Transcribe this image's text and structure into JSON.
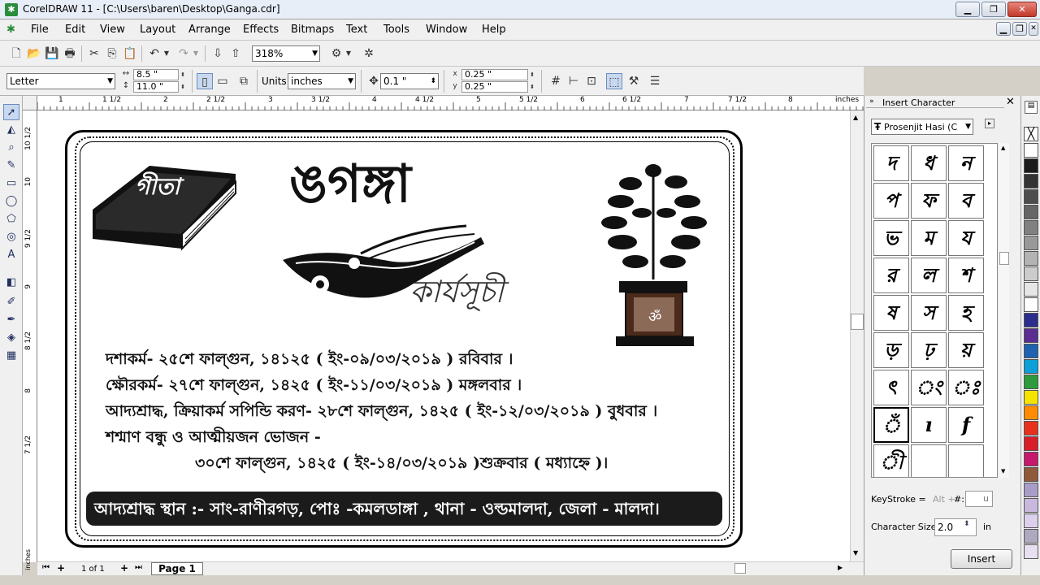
{
  "window": {
    "title": "CorelDRAW 11 - [C:\\Users\\baren\\Desktop\\Ganga.cdr]",
    "app_icon": "corel-balloon-icon"
  },
  "menu": {
    "items": [
      "File",
      "Edit",
      "View",
      "Layout",
      "Arrange",
      "Effects",
      "Bitmaps",
      "Text",
      "Tools",
      "Window",
      "Help"
    ]
  },
  "toolbar": {
    "zoom": "318%"
  },
  "property_bar": {
    "paper": "Letter",
    "width": "8.5 \"",
    "height": "11.0 \"",
    "units_label": "Units:",
    "units": "inches",
    "nudge": "0.1 \"",
    "dup_x": "0.25 \"",
    "dup_y": "0.25 \""
  },
  "rulers": {
    "h_labels": [
      "1",
      "1 1/2",
      "2",
      "2 1/2",
      "3",
      "3 1/2",
      "4",
      "4 1/2",
      "5",
      "5 1/2",
      "6",
      "6 1/2",
      "7",
      "7 1/2",
      "8"
    ],
    "unit": "inches",
    "v_labels": [
      "10 1/2",
      "10",
      "9 1/2",
      "9",
      "8 1/2",
      "8",
      "7 1/2"
    ]
  },
  "document": {
    "title": "ঙগঙ্গা",
    "subtitle": "কার্যসূচী",
    "book_title": "গীতা",
    "lines": [
      "দশাকর্ম- ২৫শে ফাল্গুন, ১৪১২৫ ( ইং-০৯/০৩/২০১৯ ) রবিবার ।",
      "ক্ষৌরকর্ম- ২৭শে ফাল্গুন, ১৪২৫ ( ইং-১১/০৩/২০১৯ ) মঙ্গলবার ।",
      "আদ্যশ্রাদ্ধ, ক্রিয়াকর্ম সপিন্ডি করণ- ২৮শে ফাল্গুন, ১৪২৫ ( ইং-১২/০৩/২০১৯ ) বুধবার ।",
      "শশ্মাণ বন্ধু ও আত্মীয়জন ভোজন -",
      "৩০শে ফাল্গুন, ১৪২৫ ( ইং-১৪/০৩/২০১৯ )শুক্রবার  ( মধ্যাহ্নে )।"
    ],
    "banner": "আদ্যশ্রাদ্ধ স্থান :- সাং-রাণীরগড়, পোঃ -কমলডাঙ্গা , থানা - ওল্ডমালদা, জেলা - মালদা।"
  },
  "page_nav": {
    "counter": "1 of 1",
    "tab": "Page 1"
  },
  "insert_character": {
    "title": "Insert Character",
    "font": "Prosenjit Hasi (C",
    "glyphs": [
      "দ",
      "ধ",
      "ন",
      "প",
      "ফ",
      "ব",
      "ভ",
      "ম",
      "য",
      "র",
      "ল",
      "শ",
      "ষ",
      "স",
      "হ",
      "ড়",
      "ঢ়",
      "য়",
      "ৎ",
      "ং",
      "ঃ",
      "ঁ",
      "ı",
      "f",
      "ী",
      "",
      ""
    ],
    "keystroke_label": "KeyStroke =",
    "keystroke_alt": "Alt +",
    "keystroke_hash": "#:",
    "keystroke_value": "u",
    "size_label": "Character Size:",
    "size_value": "2.0",
    "size_unit": "in",
    "insert_button": "Insert"
  },
  "palette": {
    "colors": [
      "#ffffff",
      "#1a1a1a",
      "#333333",
      "#4d4d4d",
      "#666666",
      "#808080",
      "#999999",
      "#b3b3b3",
      "#cccccc",
      "#e6e6e6",
      "#ffffff",
      "#2b2e8c",
      "#5b2d90",
      "#1e62b0",
      "#0d9fd8",
      "#2d9a3e",
      "#f5e400",
      "#ff8c00",
      "#e8301c",
      "#d81e2a",
      "#c7196b",
      "#8f5a3c",
      "#a89cc8",
      "#c8b8de",
      "#dcd0ec",
      "#b0a8c0",
      "#e8e0f0"
    ]
  }
}
